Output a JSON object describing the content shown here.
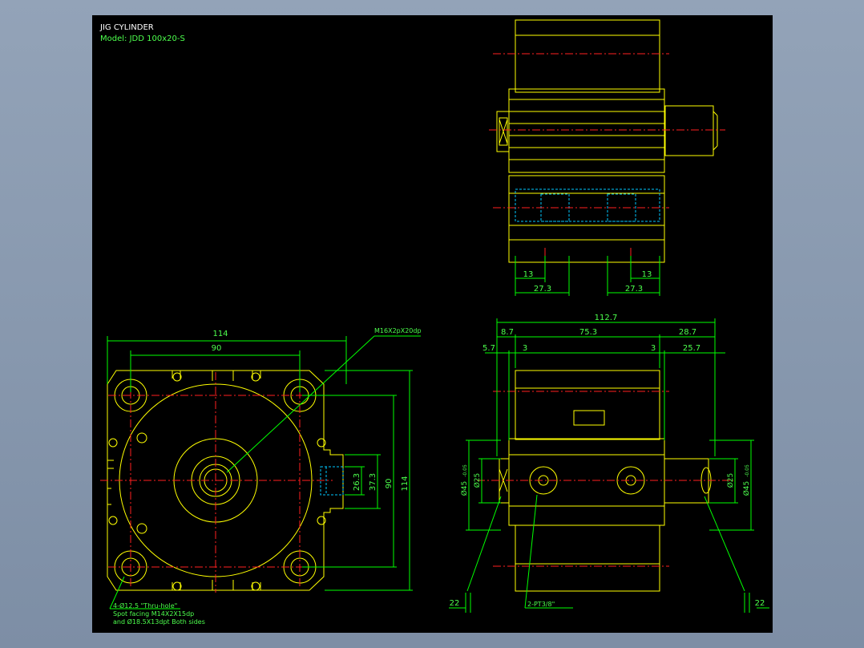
{
  "title": "JIG CYLINDER",
  "model": "Model: JDD 100x20-S",
  "colors": {
    "outline": "#ffff00",
    "dimension": "#00ff00",
    "center": "#ff2020",
    "hidden": "#00c8ff",
    "text": "#ffffff"
  },
  "front_view": {
    "width_outer": "114",
    "width_inner": "90",
    "height_outer": "114",
    "height_inner": "90",
    "port_h1": "37.3",
    "port_h2": "26.3",
    "rod_thread": "M16X2pX20dp",
    "note_line1": "4-Ø12.5 \"Thru-hole\"",
    "note_line2": "Spot facing M14X2X15dp",
    "note_line3": "and Ø18.5X13dpt Both sides"
  },
  "top_view": {
    "dim_13_left": "13",
    "dim_13_right": "13",
    "dim_273_left": "27.3",
    "dim_273_right": "27.3"
  },
  "side_view": {
    "overall": "112.7",
    "d_87": "8.7",
    "d_753": "75.3",
    "d_287": "28.7",
    "d_57": "5.7",
    "d_3a": "3",
    "d_3b": "3",
    "d_257": "25.7",
    "dia25_left": "Ø25",
    "dia45_left": "Ø45",
    "tol_left": "-0.05",
    "dia25_right": "Ø25",
    "dia45_right": "Ø45",
    "tol_right": "-0.05",
    "port": "2-PT3/8\"",
    "dim_22_left": "22",
    "dim_22_right": "22"
  }
}
